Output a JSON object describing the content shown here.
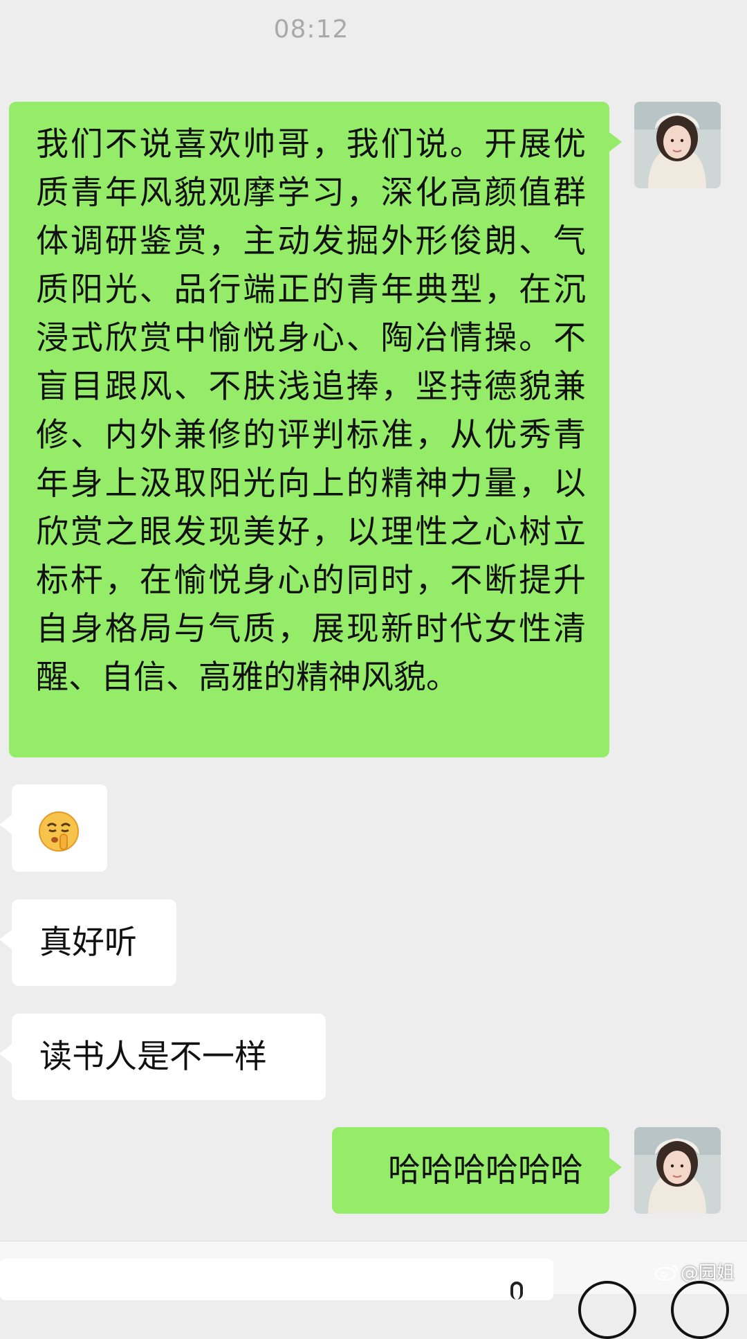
{
  "timestamp": "08:12",
  "messages": [
    {
      "side": "out",
      "text": " 我们不说喜欢帅哥，我们说。开展优质青年风貌观摩学习，深化高颜值群体调研鉴赏，主动发掘外形俊朗、气质阳光、品行端正的青年典型，在沉浸式欣赏中愉悦身心、陶冶情操。不盲目跟风、不肤浅追捧，坚持德貌兼修、内外兼修的评判标准，从优秀青年身上汲取阳光向上的精神力量，以欣赏之眼发现美好，以理性之心树立标杆，在愉悦身心的同时，不断提升自身格局与气质，展现新时代女性清醒、自信、高雅的精神风貌。"
    },
    {
      "side": "in",
      "emoji": "shushing-face-emoji"
    },
    {
      "side": "in",
      "text": "真好听"
    },
    {
      "side": "in",
      "text": "读书人是不一样"
    },
    {
      "side": "out",
      "text": "哈哈哈哈哈哈"
    }
  ],
  "watermark": "@园姐",
  "colors": {
    "background": "#ededed",
    "outgoing_bubble": "#95ec69",
    "incoming_bubble": "#ffffff",
    "timestamp": "#a9a9a9"
  },
  "icons": {
    "emoji_button": "smiley-icon",
    "add_button": "plus-circle-icon",
    "voice": "voice-icon",
    "watermark_logo": "weibo-logo"
  }
}
